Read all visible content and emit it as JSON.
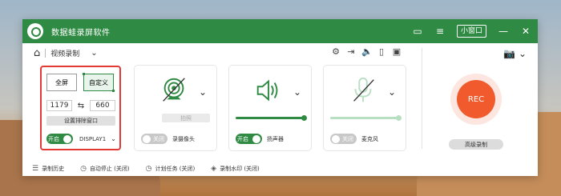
{
  "app": {
    "title": "数据蛙录屏软件",
    "mini_label": "小窗口"
  },
  "titlebar_icons": [
    "message-icon",
    "menu-icon",
    "minimize-icon",
    "close-icon"
  ],
  "toolbar": {
    "mode": "视频录制"
  },
  "screen": {
    "fullscreen": "全屏",
    "custom": "自定义",
    "width": "1179",
    "height": "660",
    "set_region": "设置排除窗口",
    "toggle": "开启",
    "display": "DISPLAY1"
  },
  "webcam": {
    "snapshot": "拍照",
    "toggle": "关闭",
    "label": "录摄像头"
  },
  "speaker": {
    "toggle": "开启",
    "label": "扬声器",
    "volume": 1.0
  },
  "mic": {
    "toggle": "关闭",
    "label": "麦克风",
    "volume": 1.0
  },
  "rec": {
    "label": "REC",
    "advanced": "高级录制"
  },
  "footer": {
    "history": "录制历史",
    "auto_stop": "自动停止 (关闭)",
    "schedule": "计划任务 (关闭)",
    "watermark": "录制水印 (关闭)"
  },
  "colors": {
    "brand": "#2f8a43",
    "rec": "#f05a2c",
    "highlight": "#e53935"
  }
}
